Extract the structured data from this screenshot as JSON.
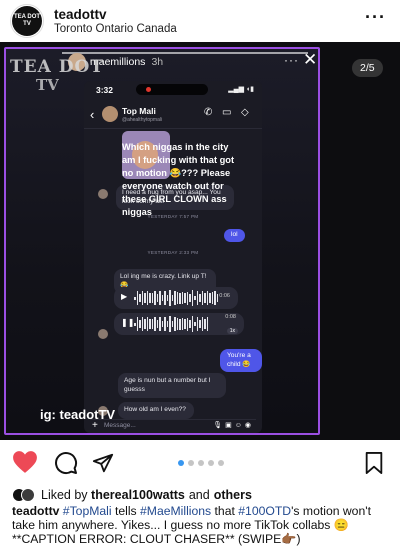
{
  "post": {
    "username": "teadottv",
    "location": "Toronto Ontario Canada",
    "avatar_text": "TEA DOT TV",
    "counter": "2/5"
  },
  "story": {
    "watermark_top": "TEA DOT",
    "watermark_tv": "TV",
    "user": "maemillions",
    "time": "3h",
    "overlay_caption": "Which niggas in the city am I fucking with that got no motion 😂??? Please everyone watch out for these GIRL CLOWN ass niggas",
    "overlay_ig": "ig: teadotTV"
  },
  "chat": {
    "status_time": "3:32",
    "contact_name": "Top Mali",
    "contact_handle": "@ahealthytopmali",
    "messages": [
      {
        "dir": "in",
        "text": "I need a hug from you asap... You look comfy asf"
      },
      {
        "dir": "out",
        "text": "lol"
      },
      {
        "dir": "in",
        "text": "Lol ing me is crazy. Link up T!😂"
      },
      {
        "dir": "out",
        "text": "You're a child 😂"
      },
      {
        "dir": "in",
        "text": "Age is nun but a number but I guesss"
      },
      {
        "dir": "in",
        "text": "How old am I even??"
      }
    ],
    "timestamps": [
      "YESTERDAY 7:57 PM",
      "YESTERDAY 2:33 PM"
    ],
    "voice_notes": [
      {
        "duration": "0:06"
      },
      {
        "duration": "0:08",
        "speed": "1x"
      }
    ],
    "composer_placeholder": "Message..."
  },
  "actions": {
    "icons": [
      "heart-icon",
      "comment-icon",
      "share-icon",
      "save-icon"
    ],
    "carousel_count": 5,
    "carousel_active": 1
  },
  "likes": {
    "prefix": "Liked by",
    "user": "thereal100watts",
    "joiner": "and",
    "others": "others"
  },
  "caption": {
    "username": "teadottv",
    "parts": [
      {
        "type": "tag",
        "text": "#TopMali"
      },
      {
        "type": "text",
        "text": " tells "
      },
      {
        "type": "tag",
        "text": "#MaeMillions"
      },
      {
        "type": "text",
        "text": " that "
      },
      {
        "type": "tag",
        "text": "#100OTD"
      },
      {
        "type": "text",
        "text": "'s motion won't take him anywhere. Yikes... I guess no more TikTok collabs 😑 **CAPTION ERROR: CLOUT CHASER** (SWIPE👉🏾)"
      }
    ]
  },
  "colors": {
    "heart": "#ed4956",
    "accent_blue": "#3897f0",
    "frame_purple": "#9b4fe3",
    "bubble_out": "#4f56e8",
    "hashtag": "#234a8f"
  }
}
